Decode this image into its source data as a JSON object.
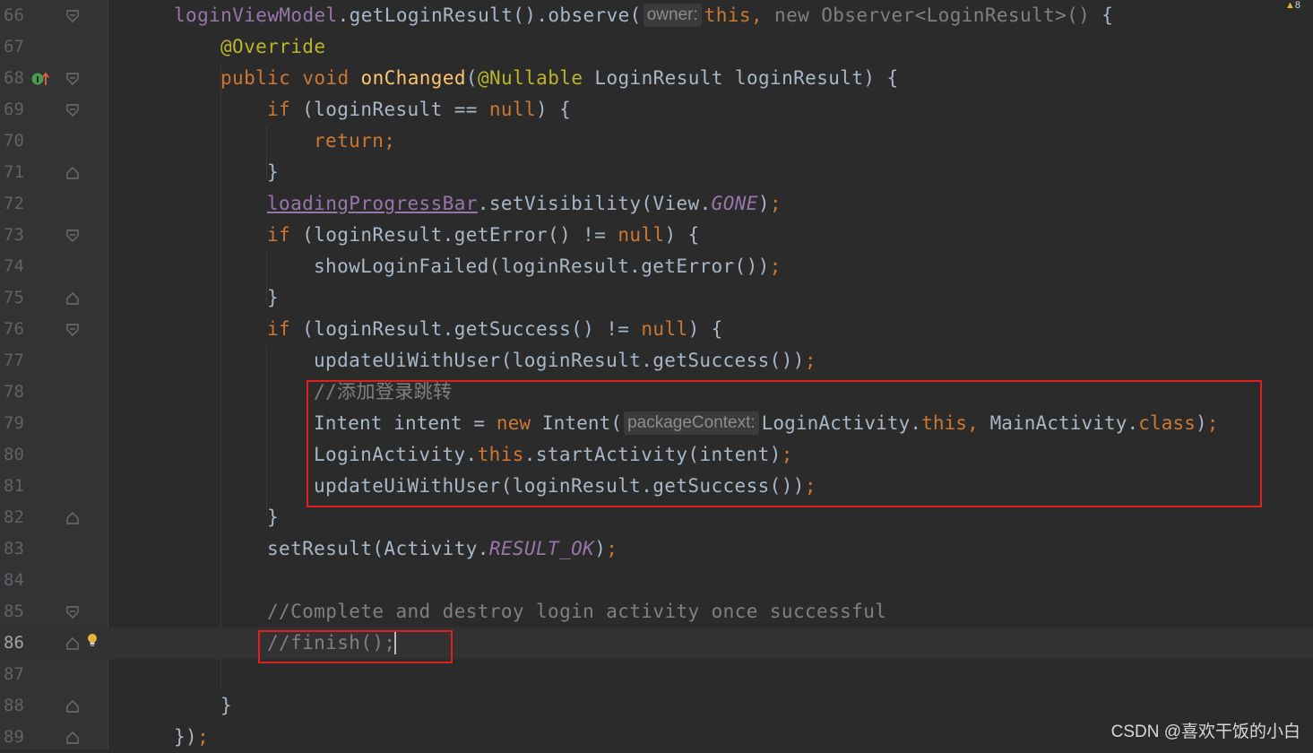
{
  "editor": {
    "warning_badge": {
      "icon": "warning-triangle-icon",
      "count": "8"
    },
    "lines": [
      {
        "num": "66",
        "indent": 0
      },
      {
        "num": "67",
        "indent": 1
      },
      {
        "num": "68",
        "indent": 1
      },
      {
        "num": "69",
        "indent": 2
      },
      {
        "num": "70",
        "indent": 3
      },
      {
        "num": "71",
        "indent": 2
      },
      {
        "num": "72",
        "indent": 2
      },
      {
        "num": "73",
        "indent": 2
      },
      {
        "num": "74",
        "indent": 3
      },
      {
        "num": "75",
        "indent": 2
      },
      {
        "num": "76",
        "indent": 2
      },
      {
        "num": "77",
        "indent": 3
      },
      {
        "num": "78",
        "indent": 3
      },
      {
        "num": "79",
        "indent": 3
      },
      {
        "num": "80",
        "indent": 3
      },
      {
        "num": "81",
        "indent": 3
      },
      {
        "num": "82",
        "indent": 2
      },
      {
        "num": "83",
        "indent": 2
      },
      {
        "num": "84",
        "indent": 2
      },
      {
        "num": "85",
        "indent": 2
      },
      {
        "num": "86",
        "indent": 2
      },
      {
        "num": "87",
        "indent": 1
      },
      {
        "num": "88",
        "indent": 1
      },
      {
        "num": "89",
        "indent": 0
      }
    ],
    "code": {
      "l66": {
        "a": "loginViewModel",
        "b": ".getLoginResult().observe(",
        "hint": "owner:",
        "c": "this",
        "d": ", ",
        "e": "new ",
        "f": "Observer<LoginResult>() ",
        "g": "{"
      },
      "l67": {
        "a": "@Override"
      },
      "l68": {
        "a": "public ",
        "b": "void ",
        "c": "onChanged",
        "d": "(",
        "e": "@Nullable",
        "f": " LoginResult loginResult) {"
      },
      "l69": {
        "a": "if ",
        "b": "(loginResult == ",
        "c": "null",
        "d": ") {"
      },
      "l70": {
        "a": "return;"
      },
      "l71": {
        "a": "}"
      },
      "l72": {
        "a": "loadingProgressBar",
        "b": ".setVisibility(View.",
        "c": "GONE",
        "d": ")",
        "e": ";"
      },
      "l73": {
        "a": "if ",
        "b": "(loginResult.getError() != ",
        "c": "null",
        "d": ") {"
      },
      "l74": {
        "a": "showLoginFailed(loginResult.getError())",
        "b": ";"
      },
      "l75": {
        "a": "}"
      },
      "l76": {
        "a": "if ",
        "b": "(loginResult.getSuccess() != ",
        "c": "null",
        "d": ") {"
      },
      "l77": {
        "a": "updateUiWithUser(loginResult.getSuccess())",
        "b": ";"
      },
      "l78": {
        "a": "//添加登录跳转"
      },
      "l79": {
        "a": "Intent intent = ",
        "b": "new ",
        "c": "Intent(",
        "hint": "packageContext:",
        "d": "LoginActivity.",
        "e": "this",
        "f": ", ",
        "g": "MainActivity.",
        "h": "class",
        "i": ")",
        "j": ";"
      },
      "l80": {
        "a": "LoginActivity.",
        "b": "this",
        "c": ".startActivity(intent)",
        "d": ";"
      },
      "l81": {
        "a": "updateUiWithUser(loginResult.getSuccess())",
        "b": ";"
      },
      "l82": {
        "a": "}"
      },
      "l83": {
        "a": "setResult(Activity.",
        "b": "RESULT_OK",
        "c": ")",
        "d": ";"
      },
      "l84": {},
      "l85": {
        "a": "//Complete and destroy login activity once successful"
      },
      "l86": {
        "a": "//finish();"
      },
      "l87": {},
      "l88": {
        "a": "}"
      },
      "l89": {
        "a": "})",
        "b": ";"
      }
    }
  },
  "watermark": "CSDN @喜欢干饭的小白",
  "colors": {
    "background": "#2b2b2b",
    "keyword": "#cc7832",
    "annotation": "#bbb529",
    "method_decl": "#ffc66d",
    "field": "#9876aa",
    "comment": "#808080",
    "text": "#a9b7c6",
    "highlight_box": "#e02020"
  }
}
